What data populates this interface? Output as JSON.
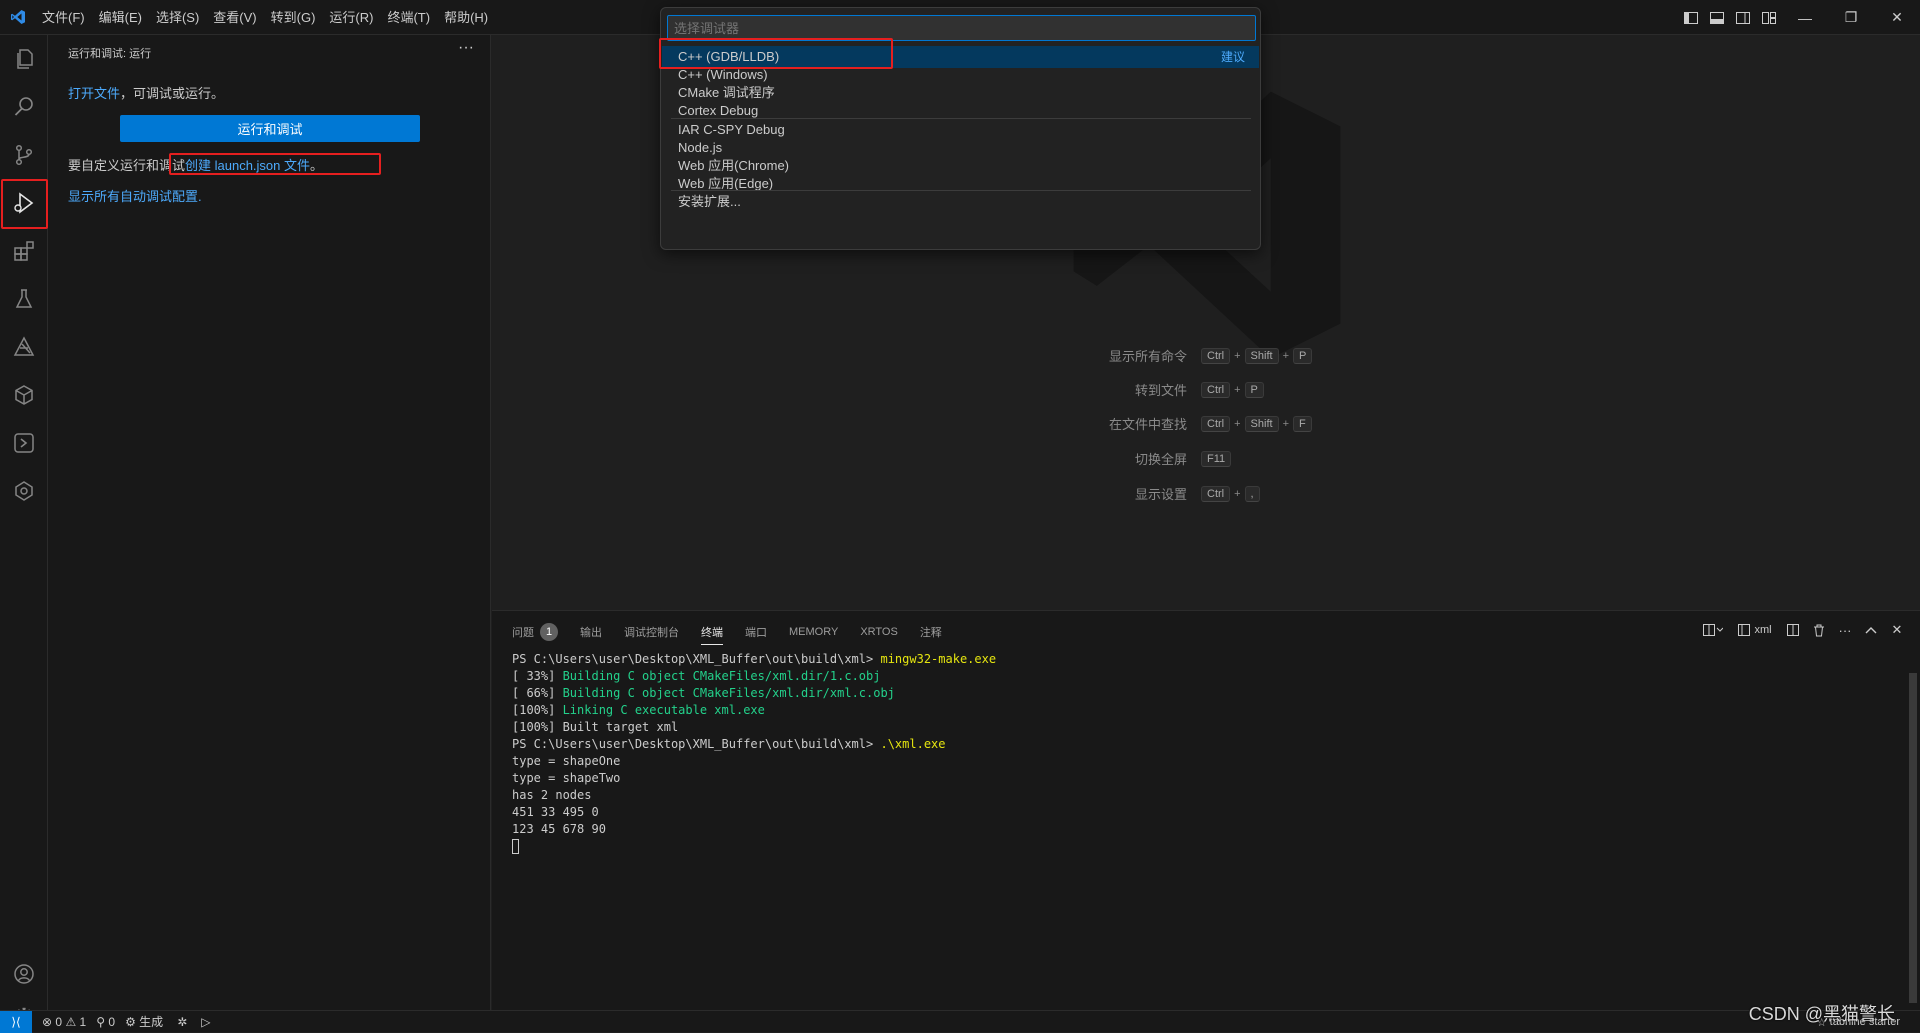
{
  "menu": [
    "文件(F)",
    "编辑(E)",
    "选择(S)",
    "查看(V)",
    "转到(G)",
    "运行(R)",
    "终端(T)",
    "帮助(H)"
  ],
  "colors": {
    "accent": "#0078d4",
    "highlight": "#e51f1f",
    "link": "#4daafc"
  },
  "activity_icons": [
    "files-icon",
    "search-icon",
    "source-control-icon",
    "run-debug-icon",
    "extensions-icon",
    "testing-icon",
    "tabnine-icon",
    "cmake-icon",
    "remote-explorer-icon",
    "tabnine-chat-icon",
    "account-icon",
    "manage-gear-icon"
  ],
  "sidebar": {
    "title": "运行和调试: 运行",
    "more": "···",
    "open_file_link": "打开文件",
    "open_file_suffix": "，可调试或运行。",
    "run_button": "运行和调试",
    "customize_prefix": "要自定义运行和调试",
    "create_launch_link": "创建 launch.json 文件",
    "create_launch_suffix": "。",
    "show_all_link": "显示所有自动调试配置",
    "show_all_suffix": "."
  },
  "quickpick": {
    "placeholder": "选择调试器",
    "items": [
      {
        "label": "C++ (GDB/LLDB)",
        "badge": "建议"
      },
      {
        "label": "C++ (Windows)"
      },
      {
        "label": "CMake 调试程序"
      },
      {
        "label": "Cortex Debug"
      },
      {
        "label": "IAR C-SPY Debug"
      },
      {
        "label": "Node.js"
      },
      {
        "label": "Web 应用(Chrome)"
      },
      {
        "label": "Web 应用(Edge)"
      },
      {
        "label": "安装扩展..."
      }
    ]
  },
  "shortcuts": [
    {
      "label": "显示所有命令",
      "keys": [
        "Ctrl",
        "Shift",
        "P"
      ]
    },
    {
      "label": "转到文件",
      "keys": [
        "Ctrl",
        "P"
      ]
    },
    {
      "label": "在文件中查找",
      "keys": [
        "Ctrl",
        "Shift",
        "F"
      ]
    },
    {
      "label": "切换全屏",
      "keys": [
        "F11"
      ]
    },
    {
      "label": "显示设置",
      "keys": [
        "Ctrl",
        ","
      ]
    }
  ],
  "panel": {
    "tabs": [
      "问题",
      "输出",
      "调试控制台",
      "终端",
      "端口",
      "MEMORY",
      "XRTOS",
      "注释"
    ],
    "problems_count": "1",
    "terminal_name": "xml",
    "terminal": [
      {
        "prompt": "PS C:\\Users\\user\\Desktop\\XML_Buffer\\out\\build\\xml> ",
        "cmd": "mingw32-make.exe"
      },
      {
        "prefix": "[ 33%] ",
        "green": "Building C object CMakeFiles/xml.dir/1.c.obj"
      },
      {
        "prefix": "[ 66%] ",
        "green": "Building C object CMakeFiles/xml.dir/xml.c.obj"
      },
      {
        "prefix": "[100%] ",
        "green": "Linking C executable xml.exe"
      },
      {
        "text": "[100%] Built target xml"
      },
      {
        "prompt": "PS C:\\Users\\user\\Desktop\\XML_Buffer\\out\\build\\xml> ",
        "cmd": ".\\xml.exe"
      },
      {
        "text": "type = shapeOne"
      },
      {
        "text": "type = shapeTwo"
      },
      {
        "text": "has 2 nodes"
      },
      {
        "text": "451 33 495 0"
      },
      {
        "text": "123 45 678 90"
      }
    ]
  },
  "statusbar": {
    "errors": "0",
    "warnings": "1",
    "ports": "0",
    "build": "生成",
    "tabnine": "tabnine starter",
    "watermark": "CSDN @黑猫警长"
  }
}
